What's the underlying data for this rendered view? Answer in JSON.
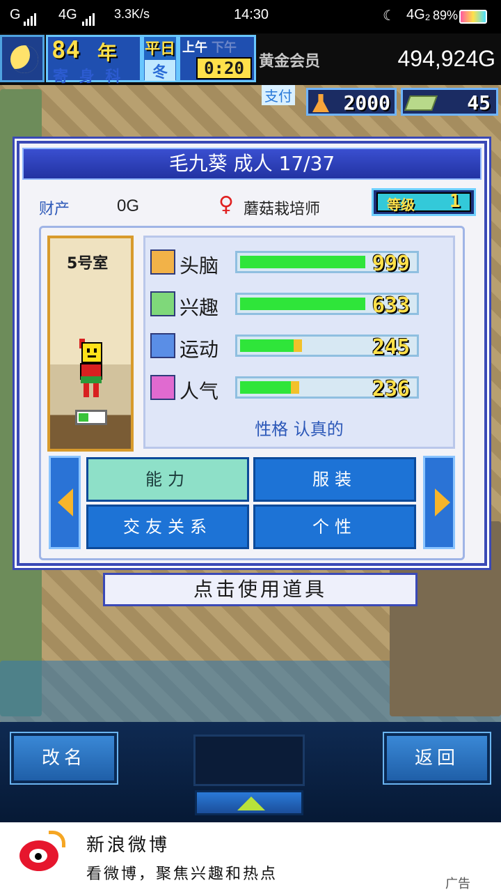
{
  "status_bar": {
    "carrier1": "G",
    "carrier2": "4G",
    "speed": "3.3K/s",
    "time": "14:30",
    "network": "4G₂",
    "battery": "89%"
  },
  "hud": {
    "year": "84",
    "year_label": "年",
    "weekday_strip": "寄 身 科",
    "day_type": "平日",
    "season": "冬",
    "am_label": "上午",
    "pm_label": "下午",
    "clock": "0:20",
    "vip_label": "黄金会员",
    "money": "494,924G"
  },
  "resources": {
    "pay_label": "支付",
    "research": "2000",
    "tickets": "45"
  },
  "dialog": {
    "title": "毛九葵 成人 17/37",
    "asset_label": "财产",
    "asset_value": "0G",
    "gender_symbol": "♀",
    "job": "蘑菇栽培师",
    "level_label": "等级",
    "level_value": "1",
    "room_label": "5号室",
    "stats": [
      {
        "name": "头脑",
        "value": "999",
        "fill": 1.0,
        "icon": "brain-icon"
      },
      {
        "name": "兴趣",
        "value": "633",
        "fill": 1.0,
        "icon": "interest-icon"
      },
      {
        "name": "运动",
        "value": "245",
        "fill": 0.55,
        "icon": "sport-icon"
      },
      {
        "name": "人气",
        "value": "236",
        "fill": 0.52,
        "icon": "popularity-icon"
      }
    ],
    "personality": "性格 认真的",
    "tabs": [
      {
        "label": "能力",
        "active": true
      },
      {
        "label": "服装",
        "active": false
      },
      {
        "label": "交友关系",
        "active": false
      },
      {
        "label": "个性",
        "active": false
      }
    ],
    "use_item_label": "点击使用道具"
  },
  "bottom": {
    "rename_label": "改名",
    "back_label": "返回"
  },
  "ad": {
    "title": "新浪微博",
    "subtitle": "看微博，聚焦兴趣和热点",
    "tag": "广告"
  },
  "colors": {
    "bar_fill": "#2fe53a",
    "panel_border": "#3a49b6",
    "tab_blue": "#1d73d6",
    "tab_active": "#8ee0c8"
  }
}
